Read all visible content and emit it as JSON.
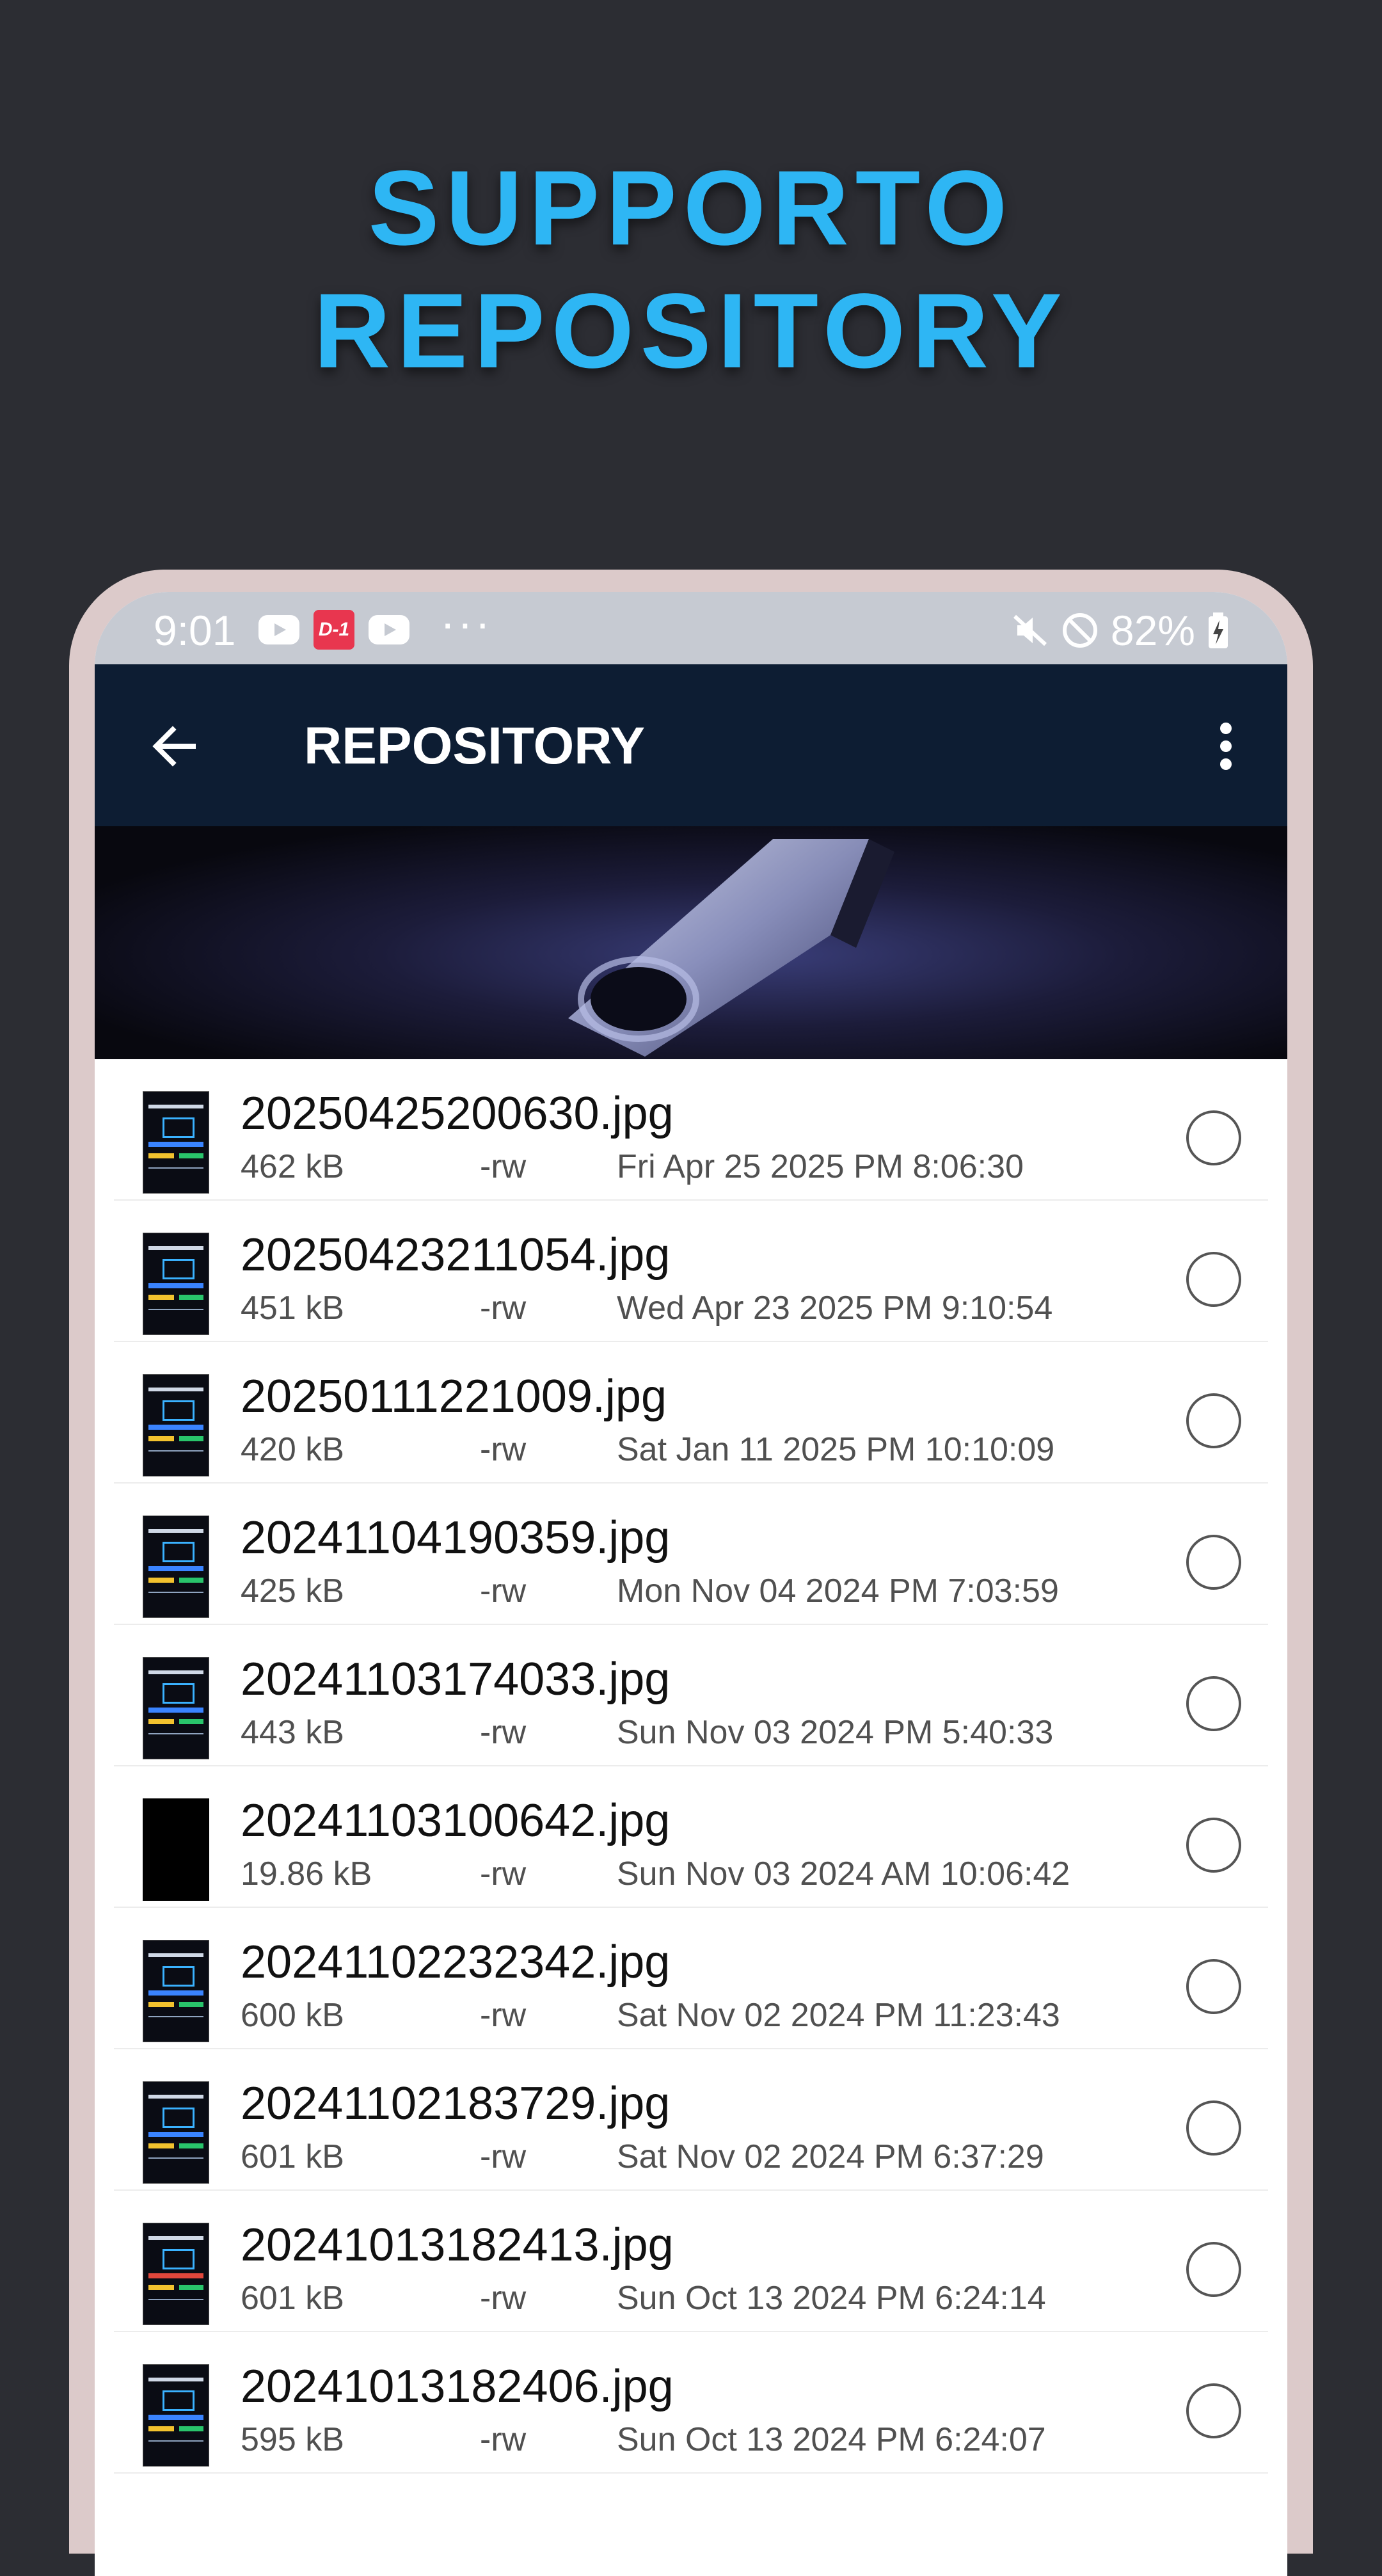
{
  "headline": {
    "line1": "SUPPORTO",
    "line2": "REPOSITORY"
  },
  "status_bar": {
    "time": "9:01",
    "battery": "82%",
    "notification_badge": "D-1"
  },
  "app_bar": {
    "title": "REPOSITORY"
  },
  "files": [
    {
      "name": "20250425200630.jpg",
      "size": "462 kB",
      "perm": "-rw",
      "date": "Fri Apr 25 2025 PM 8:06:30"
    },
    {
      "name": "20250423211054.jpg",
      "size": "451 kB",
      "perm": "-rw",
      "date": "Wed Apr 23 2025 PM 9:10:54"
    },
    {
      "name": "20250111221009.jpg",
      "size": "420 kB",
      "perm": "-rw",
      "date": "Sat Jan 11 2025 PM 10:10:09"
    },
    {
      "name": "20241104190359.jpg",
      "size": "425 kB",
      "perm": "-rw",
      "date": "Mon Nov 04 2024 PM 7:03:59"
    },
    {
      "name": "20241103174033.jpg",
      "size": "443 kB",
      "perm": "-rw",
      "date": "Sun Nov 03 2024 PM 5:40:33"
    },
    {
      "name": "20241103100642.jpg",
      "size": "19.86 kB",
      "perm": "-rw",
      "date": "Sun Nov 03 2024 AM 10:06:42"
    },
    {
      "name": "20241102232342.jpg",
      "size": "600 kB",
      "perm": "-rw",
      "date": "Sat Nov 02 2024 PM 11:23:43"
    },
    {
      "name": "20241102183729.jpg",
      "size": "601 kB",
      "perm": "-rw",
      "date": "Sat Nov 02 2024 PM 6:37:29"
    },
    {
      "name": "20241013182413.jpg",
      "size": "601 kB",
      "perm": "-rw",
      "date": "Sun Oct 13 2024 PM 6:24:14"
    },
    {
      "name": "20241013182406.jpg",
      "size": "595 kB",
      "perm": "-rw",
      "date": "Sun Oct 13 2024 PM 6:24:07"
    }
  ]
}
